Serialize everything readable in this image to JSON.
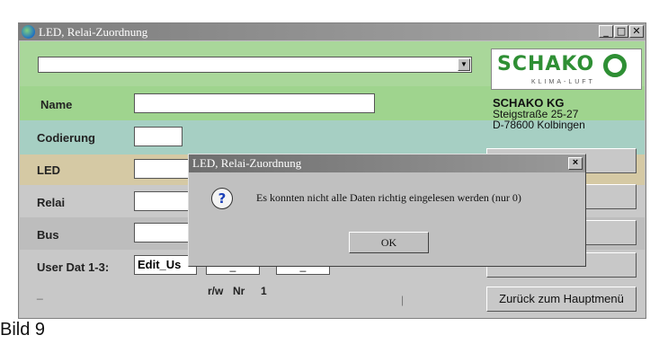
{
  "window": {
    "title": "LED, Relai-Zuordnung",
    "controls": [
      "_",
      "□",
      "✕"
    ]
  },
  "combo": {
    "value": "",
    "arrow": "▼"
  },
  "logo": {
    "text": "SCHAKO",
    "sub": "KLIMA-LUFT"
  },
  "company": {
    "name": "SCHAKO KG",
    "street": "Steigstraße 25-27",
    "city": "D-78600 Kolbingen"
  },
  "form": {
    "name_label": "Name",
    "codierung_label": "Codierung",
    "led_label": "LED",
    "relai_label": "Relai",
    "bus_label": "Bus",
    "userdat_label": "User Dat 1-3:",
    "userdat_value": "Edit_Us",
    "small_value_1": "_",
    "small_value_2": "_",
    "rw_label": "r/w",
    "nr_label": "Nr",
    "nr_value": "1",
    "dash": "_",
    "bar": "|"
  },
  "back_button": "Zurück zum Hauptmenü",
  "dialog": {
    "title": "LED, Relai-Zuordnung",
    "close": "×",
    "icon": "question-icon",
    "message": "Es konnten nicht alle Daten richtig eingelesen werden (nur 0)",
    "ok": "OK"
  },
  "caption": "Bild 9",
  "colors": {
    "band_green": "#a9d79a",
    "band_teal": "#a6cfc3",
    "band_tan": "#d5c9a4",
    "logo_green": "#2e8f34"
  }
}
